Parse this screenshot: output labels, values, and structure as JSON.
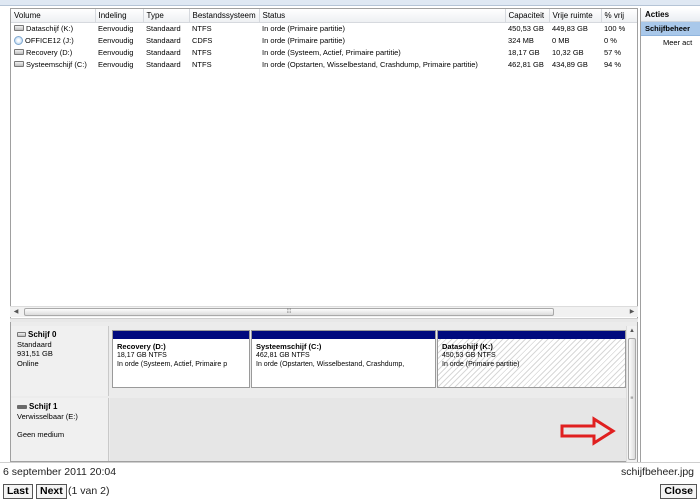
{
  "volume_list": {
    "columns": [
      "Volume",
      "Indeling",
      "Type",
      "Bestandssysteem",
      "Status",
      "Capaciteit",
      "Vrije ruimte",
      "% vrij"
    ],
    "rows": [
      {
        "icon": "drive-icon",
        "volume": "Dataschijf (K:)",
        "indeling": "Eenvoudig",
        "type": "Standaard",
        "fs": "NTFS",
        "status": "In orde (Primaire partitie)",
        "capacity": "450,53 GB",
        "free": "449,83 GB",
        "pct": "100 %"
      },
      {
        "icon": "cd-icon",
        "volume": "OFFICE12 (J:)",
        "indeling": "Eenvoudig",
        "type": "Standaard",
        "fs": "CDFS",
        "status": "In orde (Primaire partitie)",
        "capacity": "324 MB",
        "free": "0 MB",
        "pct": "0 %"
      },
      {
        "icon": "drive-icon",
        "volume": "Recovery (D:)",
        "indeling": "Eenvoudig",
        "type": "Standaard",
        "fs": "NTFS",
        "status": "In orde (Systeem, Actief, Primaire partitie)",
        "capacity": "18,17 GB",
        "free": "10,32 GB",
        "pct": "57 %"
      },
      {
        "icon": "drive-icon",
        "volume": "Systeemschijf (C:)",
        "indeling": "Eenvoudig",
        "type": "Standaard",
        "fs": "NTFS",
        "status": "In orde (Opstarten, Wisselbestand, Crashdump, Primaire partitie)",
        "capacity": "462,81 GB",
        "free": "434,89 GB",
        "pct": "94 %"
      }
    ]
  },
  "disks": {
    "disk0": {
      "name": "Schijf 0",
      "type": "Standaard",
      "size": "931,51 GB",
      "state": "Online",
      "partitions": [
        {
          "name": "Recovery  (D:)",
          "size": "18,17 GB NTFS",
          "status": "In orde (Systeem, Actief, Primaire p"
        },
        {
          "name": "Systeemschijf  (C:)",
          "size": "462,81 GB NTFS",
          "status": "In orde (Opstarten, Wisselbestand, Crashdump,"
        },
        {
          "name": "Dataschijf  (K:)",
          "size": "450,53 GB NTFS",
          "status": "In orde (Primaire partitie)"
        }
      ]
    },
    "disk1": {
      "name": "Schijf 1",
      "type": "Verwisselbaar (E:)",
      "state": "Geen medium"
    }
  },
  "actions": {
    "header": "Acties",
    "selected": "Schijfbeheer",
    "more": "Meer act"
  },
  "footer": {
    "date": "6 september 2011 20:04",
    "filename": "schijfbeheer.jpg",
    "last_label": "Last",
    "next_label": "Next",
    "page_info": "(1 van 2)",
    "close_label": "Close"
  },
  "colors": {
    "partition_bar": "#000a7e",
    "selection": "#a9c8ea",
    "arrow": "#e02020"
  }
}
